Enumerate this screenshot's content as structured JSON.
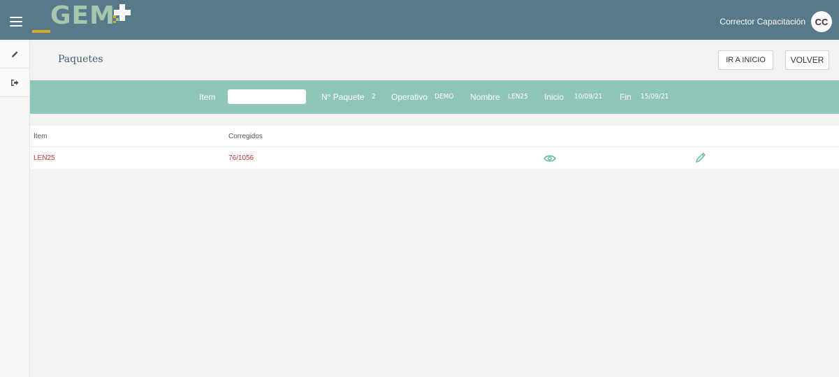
{
  "header": {
    "logo_text": "GEM",
    "user_name": "Corrector Capacitación",
    "user_initials": "CC",
    "colors": {
      "bar": "#567a8a",
      "logo_text": "#a6c7ae",
      "logo_accent": "#e0a820"
    }
  },
  "sidebar": {
    "items": [
      {
        "icon": "pencil-icon"
      },
      {
        "icon": "sign-out-icon"
      }
    ]
  },
  "page": {
    "title": "Paquetes",
    "buttons": {
      "inicio": "IR A INICIO",
      "volver": "VOLVER"
    }
  },
  "filter": {
    "item_label": "Item",
    "item_value": "",
    "paquete_label": "N° Paquete",
    "paquete_value": "2",
    "operativo_label": "Operativo",
    "operativo_value": "DEMO",
    "nombre_label": "Nombre",
    "nombre_value": "LEN25",
    "inicio_label": "Inicio",
    "inicio_value": "10/09/21",
    "fin_label": "Fin",
    "fin_value": "15/09/21",
    "color": "#90c5b9"
  },
  "table": {
    "headers": {
      "item": "Item",
      "corregidos": "Corregidos"
    },
    "rows": [
      {
        "item": "LEN25",
        "corregidos": "76/1056",
        "actions": [
          "eye-icon",
          "pencil-icon"
        ]
      }
    ],
    "row_text_color": "#c0392b"
  }
}
